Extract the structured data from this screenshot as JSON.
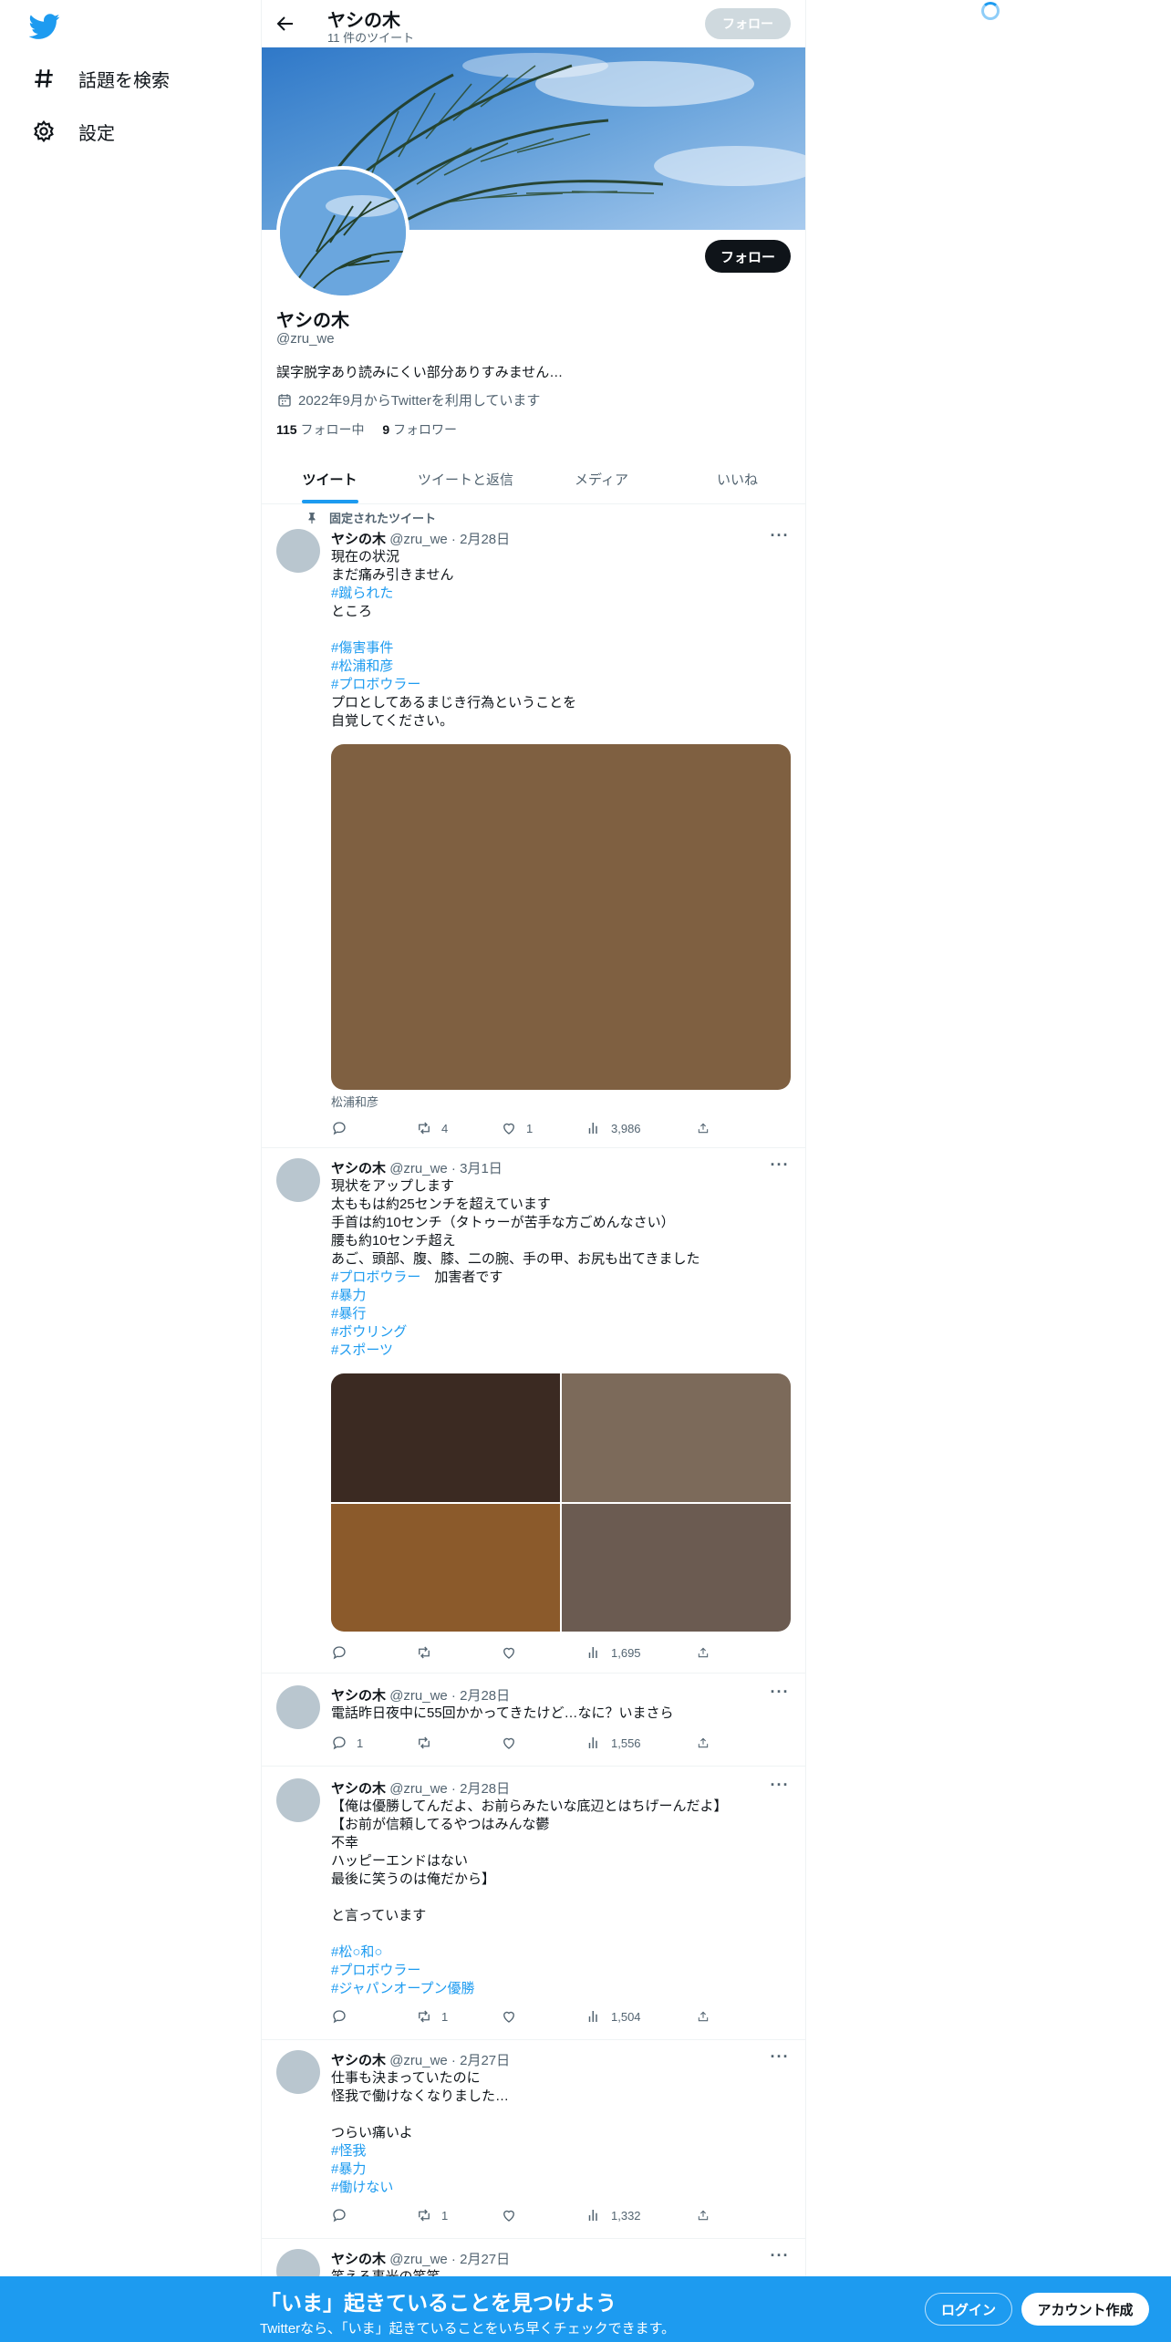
{
  "nav": {
    "logo": "twitter-bird-icon",
    "items": [
      {
        "label": "話題を検索",
        "icon": "hashtag-icon"
      },
      {
        "label": "設定",
        "icon": "gear-icon"
      }
    ]
  },
  "header": {
    "title": "ヤシの木",
    "subtitle": "11 件のツイート",
    "follow_label": "フォロー"
  },
  "profile": {
    "name": "ヤシの木",
    "handle": "@zru_we",
    "bio": "誤字脱字あり読みにくい部分ありすみません…",
    "joined": "2022年9月からTwitterを利用しています",
    "following_count": "115",
    "following_label": "フォロー中",
    "followers_count": "9",
    "followers_label": "フォロワー",
    "follow_label": "フォロー"
  },
  "tabs": [
    "ツイート",
    "ツイートと返信",
    "メディア",
    "いいね"
  ],
  "pinned_label": "固定されたツイート",
  "tweets": [
    {
      "name": "ヤシの木",
      "meta": "@zru_we · 2月28日",
      "lines": [
        {
          "text": "現在の状況"
        },
        {
          "text": "まだ痛み引きません"
        },
        {
          "text": "#蹴られた",
          "tag": true
        },
        {
          "text": "ところ"
        },
        {
          "text": ""
        },
        {
          "text": "#傷害事件",
          "tag": true
        },
        {
          "text": "#松浦和彦",
          "tag": true
        },
        {
          "text": "#プロボウラー",
          "tag": true
        },
        {
          "text": "プロとしてあるまじき行為ということを"
        },
        {
          "text": "自覚してください。"
        }
      ],
      "media_color": "#7f6041",
      "caption": "松浦和彦",
      "reply": "",
      "retweet": "4",
      "like": "1",
      "views": "3,986"
    },
    {
      "name": "ヤシの木",
      "meta": "@zru_we · 3月1日",
      "lines": [
        {
          "text": "現状をアップします"
        },
        {
          "text": "太ももは約25センチを超えています"
        },
        {
          "text": "手首は約10センチ（タトゥーが苦手な方ごめんなさい）"
        },
        {
          "text": "腰も約10センチ超え"
        },
        {
          "text": "あご、頭部、腹、膝、二の腕、手の甲、お尻も出てきました"
        },
        {
          "text": "#プロボウラー",
          "tag": true,
          "suffix": "　加害者です"
        },
        {
          "text": "#暴力",
          "tag": true
        },
        {
          "text": "#暴行",
          "tag": true
        },
        {
          "text": "#ボウリング",
          "tag": true
        },
        {
          "text": "#スポーツ",
          "tag": true
        }
      ],
      "media_grid": [
        "#3b2a22",
        "#7c6a5a",
        "#8b5a2b",
        "#6b5b51"
      ],
      "reply": "",
      "retweet": "",
      "like": "",
      "views": "1,695"
    },
    {
      "name": "ヤシの木",
      "meta": "@zru_we · 2月28日",
      "lines": [
        {
          "text": "電話昨日夜中に55回かかってきたけど…なに？いまさら"
        }
      ],
      "reply": "1",
      "retweet": "",
      "like": "",
      "views": "1,556"
    },
    {
      "name": "ヤシの木",
      "meta": "@zru_we · 2月28日",
      "lines": [
        {
          "text": "【俺は優勝してんだよ、お前らみたいな底辺とはちげーんだよ】"
        },
        {
          "text": "【お前が信頼してるやつはみんな鬱"
        },
        {
          "text": "不幸"
        },
        {
          "text": "ハッピーエンドはない"
        },
        {
          "text": "最後に笑うのは俺だから】"
        },
        {
          "text": ""
        },
        {
          "text": "と言っています"
        },
        {
          "text": ""
        },
        {
          "text": "#松○和○",
          "tag": true
        },
        {
          "text": "#プロボウラー",
          "tag": true
        },
        {
          "text": "#ジャパンオープン優勝",
          "tag": true
        }
      ],
      "reply": "",
      "retweet": "1",
      "like": "",
      "views": "1,504"
    },
    {
      "name": "ヤシの木",
      "meta": "@zru_we · 2月27日",
      "lines": [
        {
          "text": "仕事も決まっていたのに"
        },
        {
          "text": "怪我で働けなくなりました…"
        },
        {
          "text": ""
        },
        {
          "text": "つらい痛いよ"
        },
        {
          "text": "#怪我",
          "tag": true
        },
        {
          "text": "#暴力",
          "tag": true
        },
        {
          "text": "#働けない",
          "tag": true
        }
      ],
      "reply": "",
      "retweet": "1",
      "like": "",
      "views": "1,332"
    },
    {
      "name": "ヤシの木",
      "meta": "@zru_we · 2月27日",
      "lines": [
        {
          "text": "笑える事光の笑笑"
        }
      ],
      "reply": "",
      "retweet": "",
      "like": "",
      "views": ""
    }
  ],
  "bottom_bar": {
    "title": "「いま」起きていることを見つけよう",
    "subtitle": "Twitterなら、「いま」起きていることをいち早くチェックできます。",
    "login_label": "ログイン",
    "signup_label": "アカウント作成"
  },
  "colors": {
    "accent": "#1d9bf0",
    "text": "#0f1419",
    "muted": "#536471"
  }
}
